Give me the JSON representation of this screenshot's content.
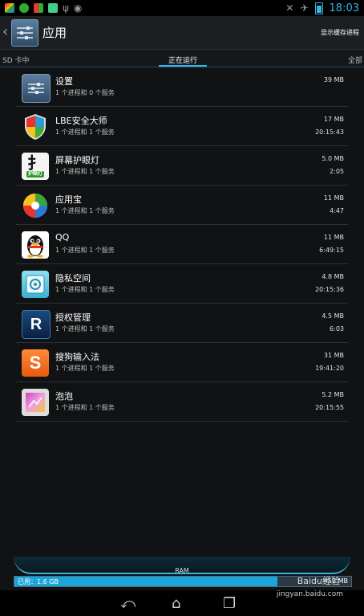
{
  "status_bar": {
    "time": "18:03",
    "left_icons": [
      "lbe-shield-icon",
      "leaf-icon",
      "windows-icon",
      "app-icon",
      "usb-icon",
      "android-icon"
    ],
    "right_icons": [
      "no-signal-icon",
      "airplane-icon",
      "battery-icon"
    ],
    "accent": "#33b5e5"
  },
  "action_bar": {
    "title": "应用",
    "action": "显示缓存进程"
  },
  "tabs": {
    "sd": "SD 卡中",
    "running": "正在运行",
    "all": "全部",
    "active": "running"
  },
  "apps": [
    {
      "name": "设置",
      "sub": "1 个进程和 0 个服务",
      "mem": "39 MB",
      "time": "",
      "icon": "settings-icon"
    },
    {
      "name": "LBE安全大师",
      "sub": "1 个进程和 1 个服务",
      "mem": "17 MB",
      "time": "20:15:43",
      "icon": "lbe-shield-icon"
    },
    {
      "name": "屏幕护眼灯",
      "sub": "1 个进程和 1 个服务",
      "mem": "5.0 MB",
      "time": "2:05",
      "icon": "eye-care-icon"
    },
    {
      "name": "应用宝",
      "sub": "1 个进程和 1 个服务",
      "mem": "11 MB",
      "time": "4:47",
      "icon": "app-store-icon"
    },
    {
      "name": "QQ",
      "sub": "1 个进程和 1 个服务",
      "mem": "11 MB",
      "time": "6:49:15",
      "icon": "qq-penguin-icon"
    },
    {
      "name": "隐私空间",
      "sub": "1 个进程和 1 个服务",
      "mem": "4.8 MB",
      "time": "20:15:36",
      "icon": "privacy-safe-icon"
    },
    {
      "name": "授权管理",
      "sub": "1 个进程和 1 个服务",
      "mem": "4.5 MB",
      "time": "6:03",
      "icon": "authorization-icon"
    },
    {
      "name": "搜狗输入法",
      "sub": "1 个进程和 1 个服务",
      "mem": "31 MB",
      "time": "19:41:20",
      "icon": "sogou-input-icon"
    },
    {
      "name": "泡泡",
      "sub": "1 个进程和 1 个服务",
      "mem": "5.2 MB",
      "time": "20:15:55",
      "icon": "bubble-icon"
    }
  ],
  "ram": {
    "label": "RAM",
    "used": "已用：1.6 GB",
    "free": "452 MB",
    "used_fraction": 0.78
  },
  "nav": {
    "back": "back-icon",
    "home": "home-icon",
    "recent": "recent-apps-icon"
  },
  "watermark": {
    "brand": "Baidu经验",
    "url": "jingyan.baidu.com"
  }
}
